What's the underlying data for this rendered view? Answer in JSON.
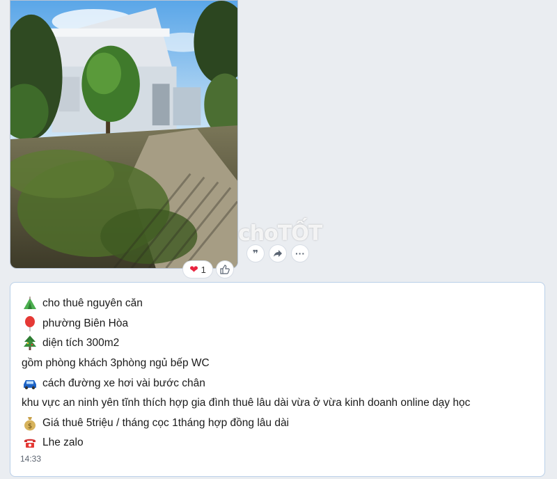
{
  "watermark": "choTỐT",
  "reactions": {
    "heart_icon": "❤",
    "count": "1"
  },
  "actions": [
    "quote-icon",
    "share-icon",
    "more-icon"
  ],
  "message": {
    "lines": [
      {
        "icon": "tent-icon",
        "text": "cho thuê nguyên căn"
      },
      {
        "icon": "balloon-pin-icon",
        "text": "phường Biên Hòa"
      },
      {
        "icon": "tree-icon",
        "text": "diện tích 300m2"
      },
      {
        "icon": "",
        "text": "gồm phòng khách 3phòng ngủ bếp WC"
      },
      {
        "icon": "car-icon",
        "text": "cách đường xe hơi vài bước chân"
      },
      {
        "icon": "",
        "text": "khu vực an ninh yên tĩnh thích hợp gia đình thuê lâu dài vừa ở vừa kinh doanh online dạy học"
      },
      {
        "icon": "money-bag-icon",
        "text": "Giá thuê 5triệu / tháng cọc 1tháng hợp đồng lâu dài"
      },
      {
        "icon": "phone-icon",
        "text": "Lhe zalo"
      }
    ],
    "time": "14:33"
  },
  "colors": {
    "bubble_border": "#b9cfe8",
    "background": "#eaedf1",
    "heart": "#e8233f"
  }
}
